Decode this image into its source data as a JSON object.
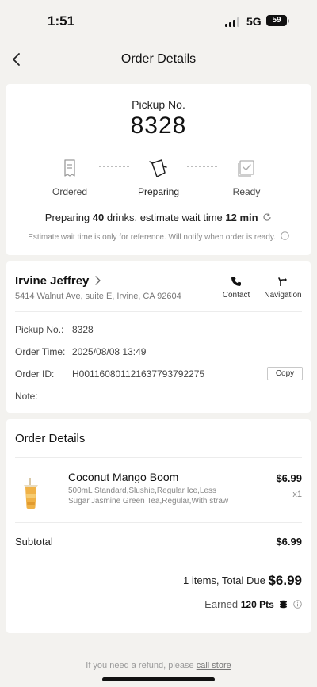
{
  "status_bar": {
    "time": "1:51",
    "network": "5G",
    "battery": "59"
  },
  "nav": {
    "title": "Order Details"
  },
  "pickup": {
    "label": "Pickup No.",
    "number": "8328",
    "steps": [
      {
        "label": "Ordered",
        "icon": "receipt-icon",
        "state": "done"
      },
      {
        "label": "Preparing",
        "icon": "pitcher-icon",
        "state": "active"
      },
      {
        "label": "Ready",
        "icon": "ready-check-icon",
        "state": "pending"
      }
    ],
    "wait_prefix": "Preparing ",
    "drinks_count": "40",
    "wait_middle": " drinks. estimate wait time ",
    "wait_minutes": "12 min",
    "note": "Estimate wait time is only for reference. Will notify when order is ready."
  },
  "store": {
    "name": "Irvine Jeffrey",
    "address": "5414 Walnut Ave, suite E, Irvine, CA 92604",
    "contact_label": "Contact",
    "navigation_label": "Navigation",
    "pickup_no_label": "Pickup No.:",
    "pickup_no_value": "8328",
    "order_time_label": "Order Time:",
    "order_time_value": "2025/08/08 13:49",
    "order_id_label": "Order ID:",
    "order_id_value": "H001160801121637793792275",
    "copy_label": "Copy",
    "note_label": "Note:",
    "note_value": ""
  },
  "order": {
    "heading": "Order Details",
    "items": [
      {
        "name": "Coconut Mango Boom",
        "description": "500mL Standard,Slushie,Regular Ice,Less Sugar,Jasmine Green Tea,Regular,With straw",
        "price": "$6.99",
        "quantity": "x1"
      }
    ],
    "subtotal_label": "Subtotal",
    "subtotal_value": "$6.99",
    "total_prefix": "1 items, Total Due ",
    "total_value": "$6.99",
    "earned_prefix": "Earned ",
    "earned_points": "120 Pts"
  },
  "footer": {
    "refund_text": "If you need a refund, please ",
    "refund_link": "call store"
  },
  "colors": {
    "background": "#f3f2ef",
    "card": "#ffffff",
    "text": "#222222",
    "muted": "#888888"
  }
}
